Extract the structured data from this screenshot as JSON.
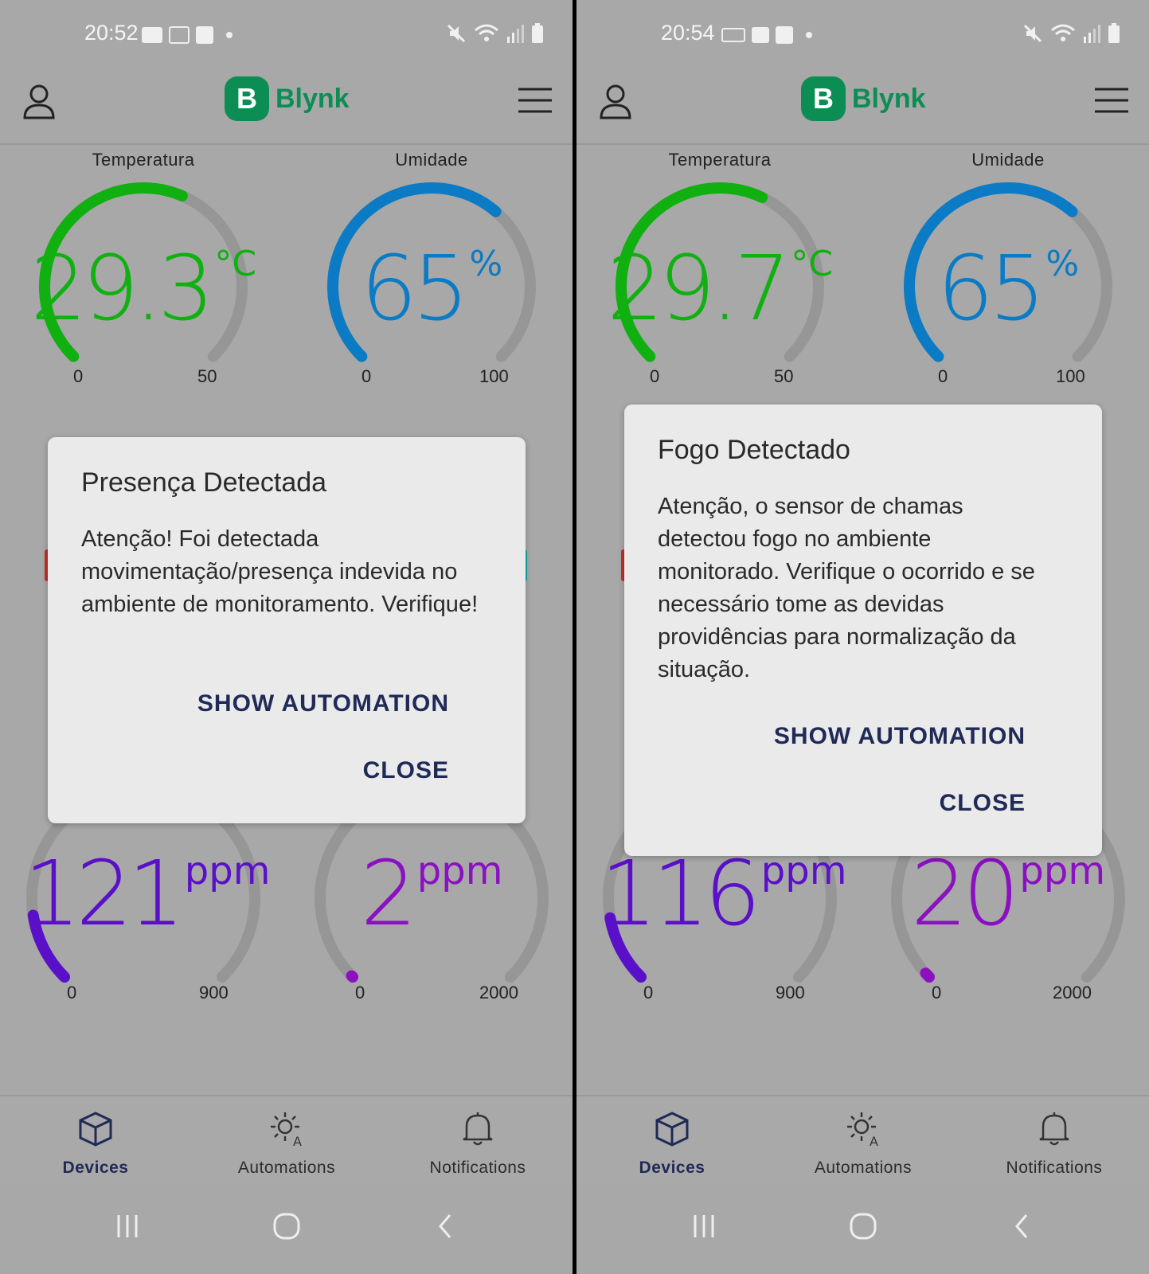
{
  "screens": [
    {
      "status_time": "20:52",
      "app_name": "Blynk",
      "logo_letter": "B",
      "gauges_top": [
        {
          "title": "Temperatura",
          "value": "29.3",
          "unit": "°C",
          "min": "0",
          "max": "50",
          "color": "#10b010",
          "fraction": 0.586
        },
        {
          "title": "Umidade",
          "value": "65",
          "unit": "%",
          "min": "0",
          "max": "100",
          "color": "#0a7bc4",
          "fraction": 0.65
        }
      ],
      "gauges_bottom": [
        {
          "value": "121",
          "unit": "ppm",
          "min": "0",
          "max": "900",
          "color": "#5a10c8",
          "fraction": 0.134
        },
        {
          "value": "2",
          "unit": "ppm",
          "min": "0",
          "max": "2000",
          "color": "#8a10c0",
          "fraction": 0.001
        }
      ],
      "dialog": {
        "title": "Presença Detectada",
        "body": "Atenção! Foi detectada movimentação/presença indevida no ambiente de monitoramento. Verifique!",
        "show_automation": "SHOW AUTOMATION",
        "close": "CLOSE"
      }
    },
    {
      "status_time": "20:54",
      "app_name": "Blynk",
      "logo_letter": "B",
      "gauges_top": [
        {
          "title": "Temperatura",
          "value": "29.7",
          "unit": "°C",
          "min": "0",
          "max": "50",
          "color": "#10b010",
          "fraction": 0.594
        },
        {
          "title": "Umidade",
          "value": "65",
          "unit": "%",
          "min": "0",
          "max": "100",
          "color": "#0a7bc4",
          "fraction": 0.65
        }
      ],
      "gauges_bottom": [
        {
          "value": "116",
          "unit": "ppm",
          "min": "0",
          "max": "900",
          "color": "#5a10c8",
          "fraction": 0.129
        },
        {
          "value": "20",
          "unit": "ppm",
          "min": "0",
          "max": "2000",
          "color": "#8a10c0",
          "fraction": 0.01
        }
      ],
      "dialog": {
        "title": "Fogo Detectado",
        "body": "Atenção, o sensor de chamas detectou fogo no ambiente monitorado.  Verifique o ocorrido e se necessário tome as devidas providências para normalização da situação.",
        "show_automation": "SHOW AUTOMATION",
        "close": "CLOSE"
      }
    }
  ],
  "bottom_nav": {
    "devices": "Devices",
    "automations": "Automations",
    "notifications": "Notifications"
  },
  "icons": [
    "profile-icon",
    "menu-icon",
    "cube-icon",
    "automation-sun-icon",
    "bell-icon",
    "recents-icon",
    "home-icon",
    "back-icon",
    "mute-icon",
    "wifi-icon",
    "signal-icon",
    "battery-icon"
  ]
}
